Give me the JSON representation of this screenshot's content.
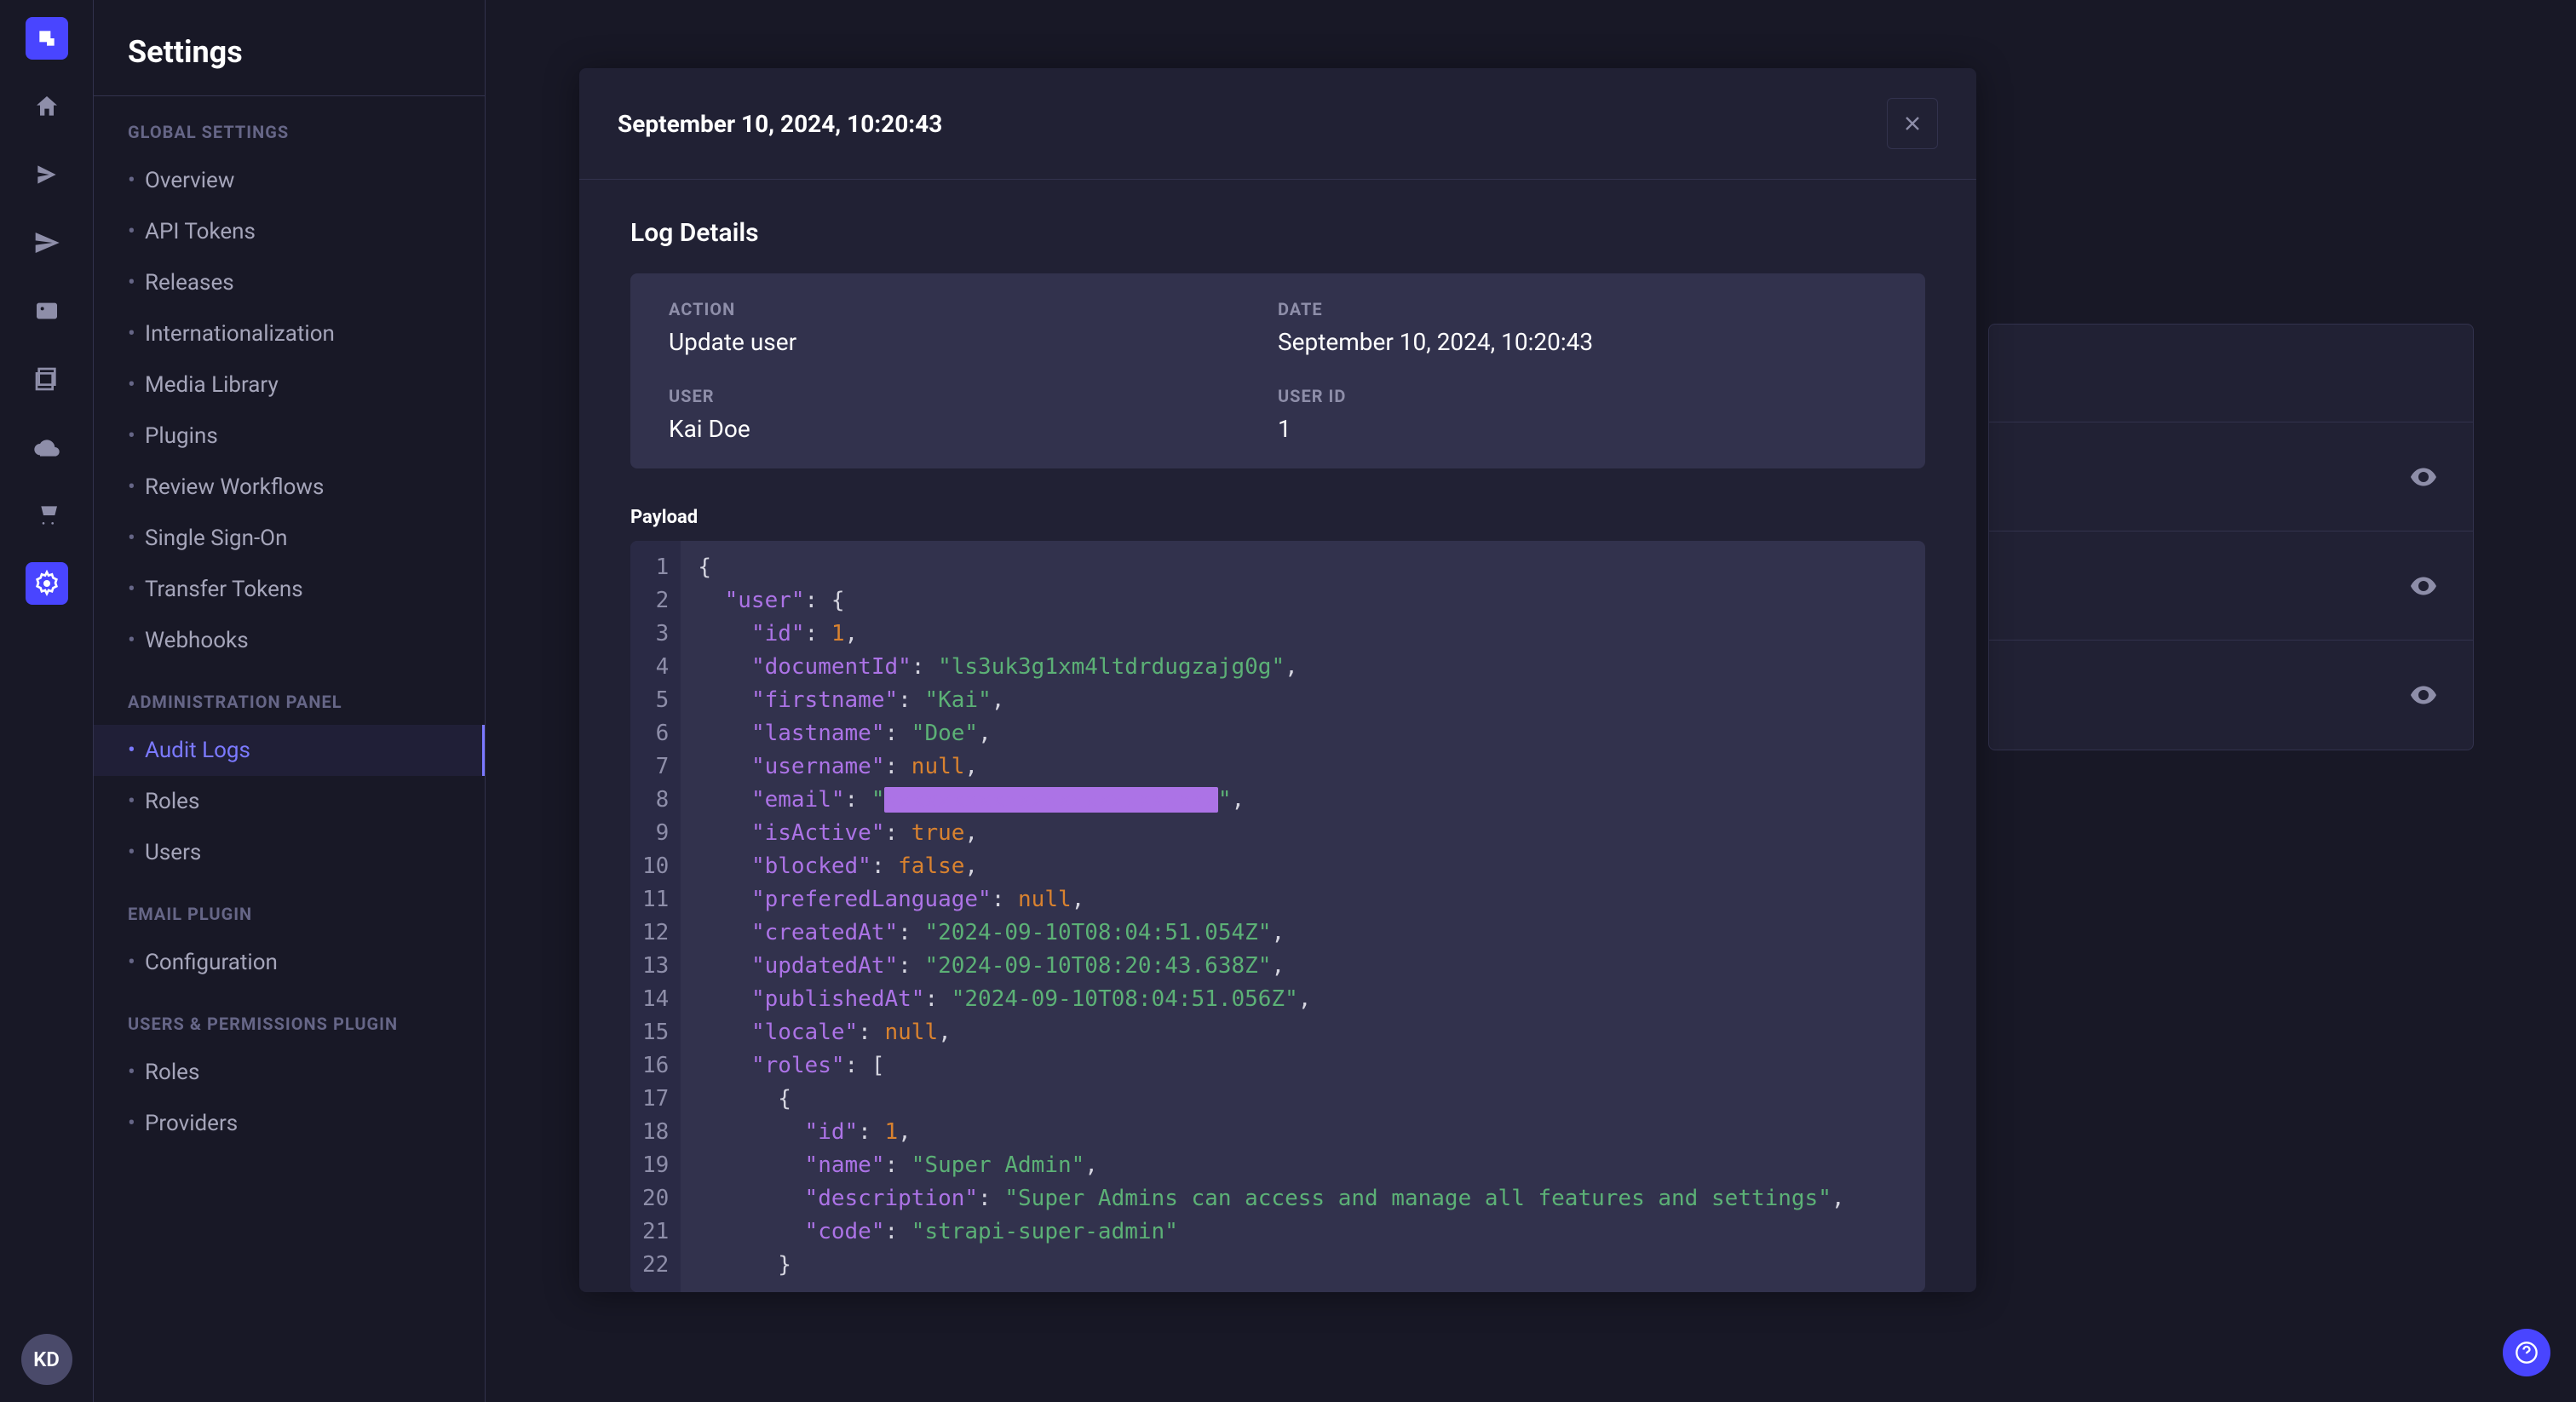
{
  "rail": {
    "avatar_initials": "KD",
    "items": [
      "home",
      "content",
      "paper-plane",
      "image",
      "layers",
      "cloud",
      "cart",
      "gear"
    ]
  },
  "sidebar": {
    "title": "Settings",
    "sections": [
      {
        "label": "GLOBAL SETTINGS",
        "items": [
          "Overview",
          "API Tokens",
          "Releases",
          "Internationalization",
          "Media Library",
          "Plugins",
          "Review Workflows",
          "Single Sign-On",
          "Transfer Tokens",
          "Webhooks"
        ]
      },
      {
        "label": "ADMINISTRATION PANEL",
        "items": [
          "Audit Logs",
          "Roles",
          "Users"
        ],
        "active_index": 0
      },
      {
        "label": "EMAIL PLUGIN",
        "items": [
          "Configuration"
        ]
      },
      {
        "label": "USERS & PERMISSIONS PLUGIN",
        "items": [
          "Roles",
          "Providers"
        ]
      }
    ]
  },
  "modal": {
    "header_timestamp": "September 10, 2024, 10:20:43",
    "log_details_title": "Log Details",
    "fields": {
      "action_label": "ACTION",
      "action_value": "Update user",
      "date_label": "DATE",
      "date_value": "September 10, 2024, 10:20:43",
      "user_label": "USER",
      "user_value": "Kai Doe",
      "user_id_label": "USER ID",
      "user_id_value": "1"
    },
    "payload_label": "Payload",
    "payload": {
      "user": {
        "id": 1,
        "documentId": "ls3uk3g1xm4ltdrdugzajg0g",
        "firstname": "Kai",
        "lastname": "Doe",
        "username": null,
        "email": "[redacted]",
        "isActive": true,
        "blocked": false,
        "preferedLanguage": null,
        "createdAt": "2024-09-10T08:04:51.054Z",
        "updatedAt": "2024-09-10T08:20:43.638Z",
        "publishedAt": "2024-09-10T08:04:51.056Z",
        "locale": null,
        "roles": [
          {
            "id": 1,
            "name": "Super Admin",
            "description": "Super Admins can access and manage all features and settings",
            "code": "strapi-super-admin"
          }
        ]
      }
    }
  },
  "colors": {
    "accent": "#4945ff",
    "key": "#ac73e6",
    "string": "#5cb176",
    "number": "#d9822f"
  }
}
